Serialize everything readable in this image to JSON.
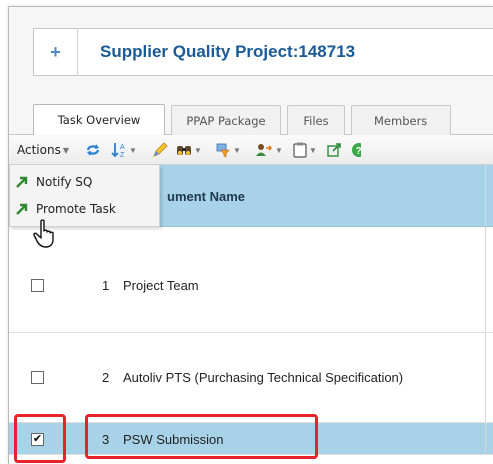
{
  "header": {
    "add_icon": "+",
    "title": "Supplier Quality Project:148713"
  },
  "tabs": [
    {
      "label": "Task Overview",
      "active": true
    },
    {
      "label": "PPAP Package",
      "active": false
    },
    {
      "label": "Files",
      "active": false
    },
    {
      "label": "Members",
      "active": false
    }
  ],
  "toolbar": {
    "actions_label": "Actions",
    "icons": [
      "refresh-icon",
      "sort-icon",
      "edit-icon",
      "find-icon",
      "filter-icon",
      "assign-icon",
      "clipboard-icon",
      "export-icon",
      "help-icon"
    ]
  },
  "menu": {
    "items": [
      {
        "label": "Notify SQ",
        "icon": "arrow-icon"
      },
      {
        "label": "Promote Task",
        "icon": "arrow-icon"
      }
    ]
  },
  "grid": {
    "column_header": "ument Name",
    "rows": [
      {
        "num": "1",
        "name": "Project Team",
        "checked": false,
        "selected": false
      },
      {
        "num": "2",
        "name": "Autoliv PTS (Purchasing Technical Specification)",
        "checked": false,
        "selected": false
      },
      {
        "num": "3",
        "name": "PSW Submission",
        "checked": true,
        "selected": true
      }
    ]
  },
  "colors": {
    "title": "#1a5a96",
    "header_bg": "#a8d2e8",
    "highlight": "#e8222a"
  }
}
